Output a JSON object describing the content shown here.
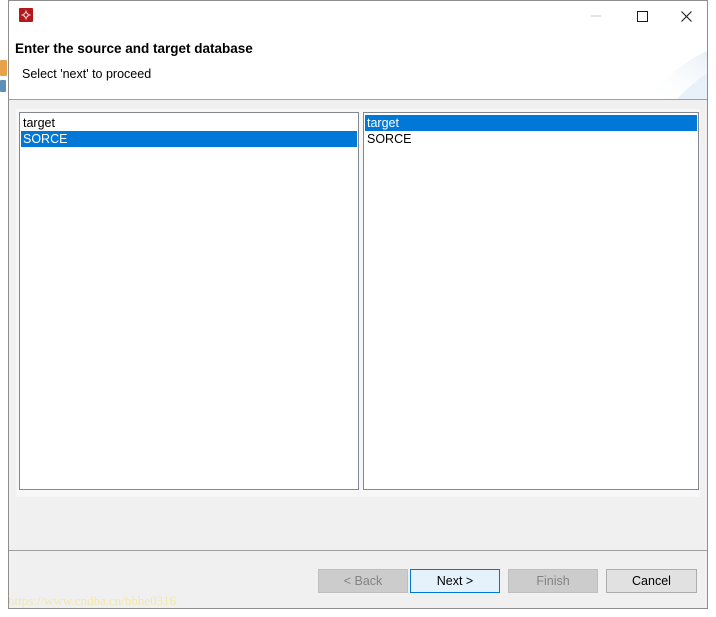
{
  "window": {
    "icon": "app-logo-icon"
  },
  "header": {
    "title": "Enter the source and target database",
    "subtitle": "Select 'next' to proceed"
  },
  "lists": {
    "source": {
      "items": [
        {
          "label": "target",
          "selected": false
        },
        {
          "label": "SORCE",
          "selected": true
        }
      ]
    },
    "target": {
      "items": [
        {
          "label": "target",
          "selected": true
        },
        {
          "label": "SORCE",
          "selected": false
        }
      ]
    }
  },
  "buttons": {
    "back": "< Back",
    "next": "Next >",
    "finish": "Finish",
    "cancel": "Cancel"
  },
  "watermark": "https://www.cndba.cn/bbhe0316",
  "colors": {
    "selection": "#0078d7",
    "default_button_border": "#0078d7",
    "app_icon": "#b3191a"
  }
}
